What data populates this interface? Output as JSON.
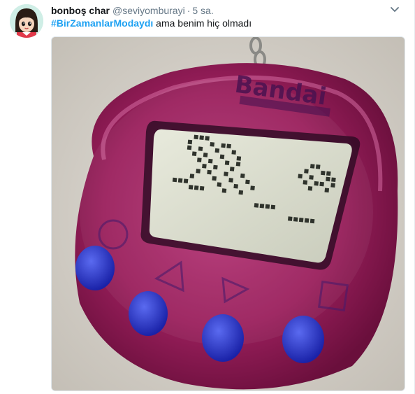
{
  "tweet": {
    "author": {
      "name": "bonboş char",
      "handle": "@seviyomburayi",
      "separator": "·",
      "time": "5 sa."
    },
    "text": {
      "hashtag": "#BirZamanlarModaydı",
      "body": " ama benim hiç olmadı"
    },
    "media": {
      "device_label": "Bandai"
    }
  },
  "icons": {
    "caret": "chevron-down-icon",
    "avatar": "cartoon-girl-avatar"
  },
  "colors": {
    "hashtag": "#1da1f2",
    "meta": "#657786",
    "device": "#a0205a",
    "buttons": "#2430c8"
  }
}
